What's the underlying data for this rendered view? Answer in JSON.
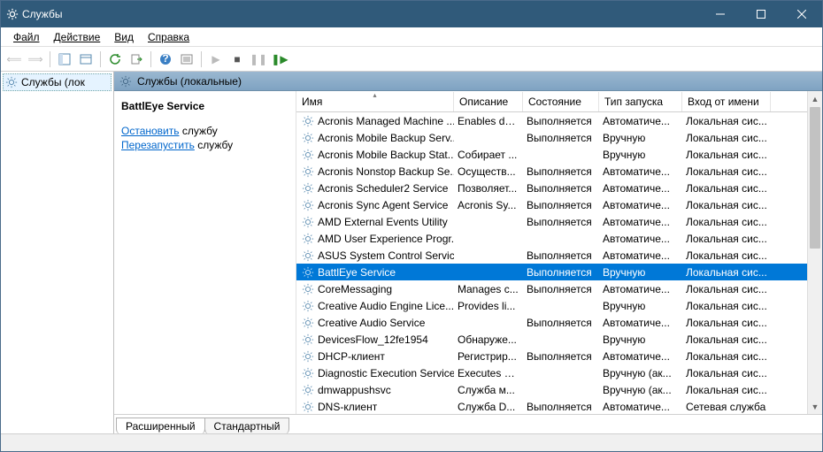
{
  "window": {
    "title": "Службы"
  },
  "menu": {
    "file": "Файл",
    "action": "Действие",
    "view": "Вид",
    "help": "Справка"
  },
  "tree": {
    "root": "Службы (лок"
  },
  "content_header": "Службы (локальные)",
  "detail": {
    "name": "BattlEye Service",
    "stop_link": "Остановить",
    "stop_suffix": " службу",
    "restart_link": "Перезапустить",
    "restart_suffix": " службу"
  },
  "columns": {
    "name": "Имя",
    "desc": "Описание",
    "state": "Состояние",
    "start": "Тип запуска",
    "logon": "Вход от имени"
  },
  "services": [
    {
      "name": "Acronis Managed Machine ...",
      "desc": "Enables da...",
      "state": "Выполняется",
      "start": "Автоматиче...",
      "logon": "Локальная сис..."
    },
    {
      "name": "Acronis Mobile Backup Serv...",
      "desc": "",
      "state": "Выполняется",
      "start": "Вручную",
      "logon": "Локальная сис..."
    },
    {
      "name": "Acronis Mobile Backup Stat...",
      "desc": "Собирает ...",
      "state": "",
      "start": "Вручную",
      "logon": "Локальная сис..."
    },
    {
      "name": "Acronis Nonstop Backup Se...",
      "desc": "Осуществ...",
      "state": "Выполняется",
      "start": "Автоматиче...",
      "logon": "Локальная сис..."
    },
    {
      "name": "Acronis Scheduler2 Service",
      "desc": "Позволяет...",
      "state": "Выполняется",
      "start": "Автоматиче...",
      "logon": "Локальная сис..."
    },
    {
      "name": "Acronis Sync Agent Service",
      "desc": "Acronis Sy...",
      "state": "Выполняется",
      "start": "Автоматиче...",
      "logon": "Локальная сис..."
    },
    {
      "name": "AMD External Events Utility",
      "desc": "",
      "state": "Выполняется",
      "start": "Автоматиче...",
      "logon": "Локальная сис..."
    },
    {
      "name": "AMD User Experience Progr...",
      "desc": "",
      "state": "",
      "start": "Автоматиче...",
      "logon": "Локальная сис..."
    },
    {
      "name": "ASUS System Control Service",
      "desc": "",
      "state": "Выполняется",
      "start": "Автоматиче...",
      "logon": "Локальная сис..."
    },
    {
      "name": "BattlEye Service",
      "desc": "",
      "state": "Выполняется",
      "start": "Вручную",
      "logon": "Локальная сис...",
      "selected": true
    },
    {
      "name": "CoreMessaging",
      "desc": "Manages c...",
      "state": "Выполняется",
      "start": "Автоматиче...",
      "logon": "Локальная сис..."
    },
    {
      "name": "Creative Audio Engine Lice...",
      "desc": "Provides li...",
      "state": "",
      "start": "Вручную",
      "logon": "Локальная сис..."
    },
    {
      "name": "Creative Audio Service",
      "desc": "",
      "state": "Выполняется",
      "start": "Автоматиче...",
      "logon": "Локальная сис..."
    },
    {
      "name": "DevicesFlow_12fe1954",
      "desc": "Обнаруже...",
      "state": "",
      "start": "Вручную",
      "logon": "Локальная сис..."
    },
    {
      "name": "DHCP-клиент",
      "desc": "Регистрир...",
      "state": "Выполняется",
      "start": "Автоматиче...",
      "logon": "Локальная сис..."
    },
    {
      "name": "Diagnostic Execution Service",
      "desc": "Executes di...",
      "state": "",
      "start": "Вручную (ак...",
      "logon": "Локальная сис..."
    },
    {
      "name": "dmwappushsvc",
      "desc": "Служба м...",
      "state": "",
      "start": "Вручную (ак...",
      "logon": "Локальная сис..."
    },
    {
      "name": "DNS-клиент",
      "desc": "Служба D...",
      "state": "Выполняется",
      "start": "Автоматиче...",
      "logon": "Сетевая служба"
    }
  ],
  "tabs": {
    "extended": "Расширенный",
    "standard": "Стандартный"
  }
}
